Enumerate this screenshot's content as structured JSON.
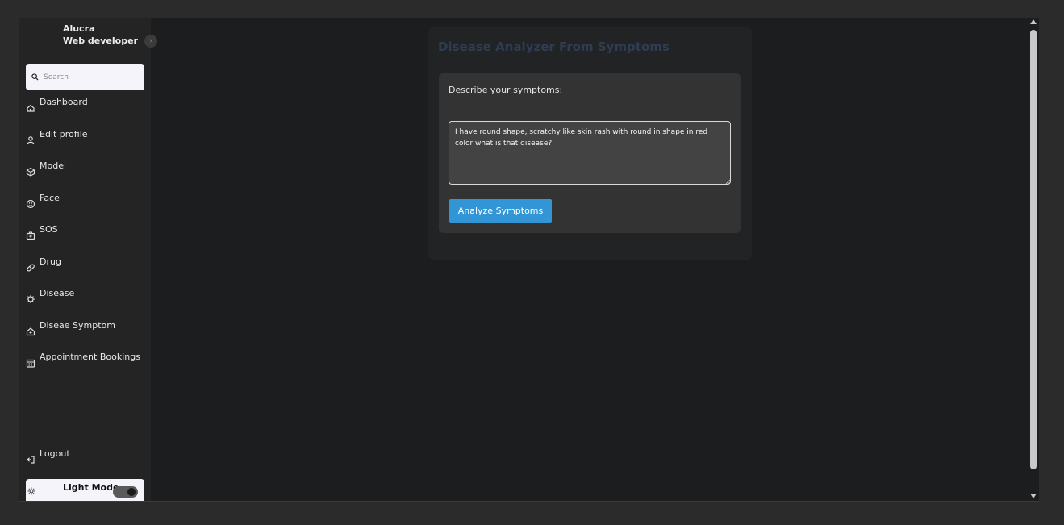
{
  "profile": {
    "name": "Alucra",
    "role": "Web developer"
  },
  "search": {
    "placeholder": "Search",
    "value": ""
  },
  "nav": {
    "items": [
      {
        "label": "Dashboard",
        "icon": "home-icon"
      },
      {
        "label": "Edit profile",
        "icon": "user-icon"
      },
      {
        "label": "Model",
        "icon": "cube-icon"
      },
      {
        "label": "Face",
        "icon": "face-icon"
      },
      {
        "label": "SOS",
        "icon": "medkit-icon"
      },
      {
        "label": "Drug",
        "icon": "pill-icon"
      },
      {
        "label": "Disease",
        "icon": "virus-icon"
      },
      {
        "label": "Diseae Symptom",
        "icon": "house-medical-icon"
      },
      {
        "label": "Appointment Bookings",
        "icon": "calendar-icon"
      }
    ],
    "logout": "Logout"
  },
  "theme": {
    "label": "Light Mode",
    "icon": "sun-icon"
  },
  "main": {
    "title": "Disease Analyzer From Symptoms",
    "prompt": "Describe your symptoms:",
    "symptoms": "I have round shape, scratchy like skin rash with round in shape in red color what is that disease?",
    "analyze_label": "Analyze Symptoms"
  },
  "colors": {
    "accent": "#3296d6",
    "title": "#2f3d52",
    "sidebar": "#242424",
    "background": "#1c1d1f"
  }
}
